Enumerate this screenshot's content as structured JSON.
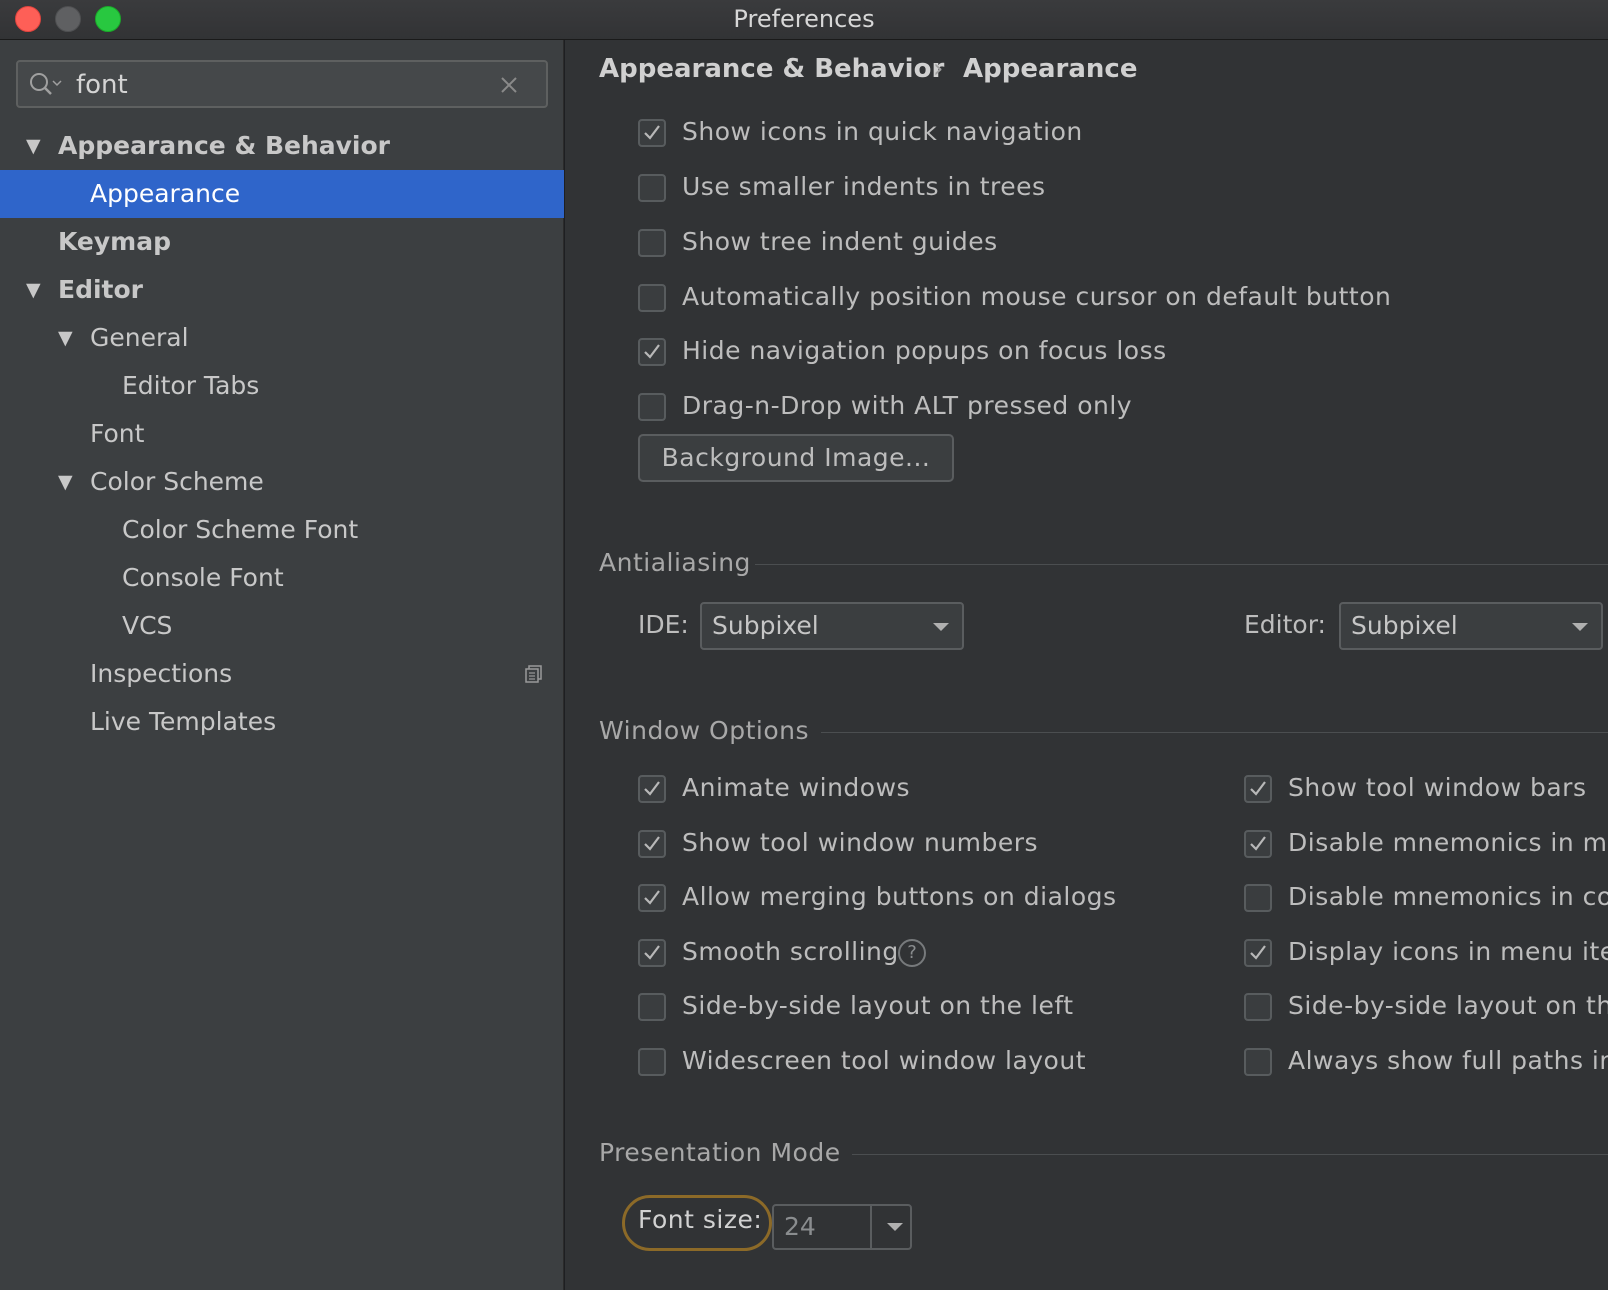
{
  "window": {
    "title": "Preferences"
  },
  "sidebar": {
    "search": {
      "value": "font"
    },
    "tree": [
      {
        "label": "Appearance & Behavior",
        "expanded": true
      },
      {
        "label": "Appearance",
        "selected": true
      },
      {
        "label": "Keymap"
      },
      {
        "label": "Editor",
        "expanded": true
      },
      {
        "label": "General",
        "expanded": true
      },
      {
        "label": "Editor Tabs"
      },
      {
        "label": "Font"
      },
      {
        "label": "Color Scheme",
        "expanded": true
      },
      {
        "label": "Color Scheme Font"
      },
      {
        "label": "Console Font"
      },
      {
        "label": "VCS"
      },
      {
        "label": "Inspections",
        "icon": "copy-icon"
      },
      {
        "label": "Live Templates"
      }
    ]
  },
  "breadcrumb": {
    "parent": "Appearance & Behavior",
    "separator": "›",
    "current": "Appearance"
  },
  "ui_options": [
    {
      "label": "Show icons in quick navigation",
      "checked": true
    },
    {
      "label": "Use smaller indents in trees",
      "checked": false
    },
    {
      "label": "Show tree indent guides",
      "checked": false
    },
    {
      "label": "Automatically position mouse cursor on default button",
      "checked": false
    },
    {
      "label": "Hide navigation popups on focus loss",
      "checked": true
    },
    {
      "label": "Drag-n-Drop with ALT pressed only",
      "checked": false
    }
  ],
  "background_image_button": "Background Image...",
  "antialiasing": {
    "title": "Antialiasing",
    "ide_label": "IDE:",
    "ide_value": "Subpixel",
    "editor_label": "Editor:",
    "editor_value": "Subpixel"
  },
  "window_options": {
    "title": "Window Options",
    "left": [
      {
        "label": "Animate windows",
        "checked": true
      },
      {
        "label": "Show tool window numbers",
        "checked": true
      },
      {
        "label": "Allow merging buttons on dialogs",
        "checked": true
      },
      {
        "label": "Smooth scrolling",
        "checked": true,
        "help": "?"
      },
      {
        "label": "Side-by-side layout on the left",
        "checked": false
      },
      {
        "label": "Widescreen tool window layout",
        "checked": false
      }
    ],
    "right": [
      {
        "label": "Show tool window bars",
        "checked": true
      },
      {
        "label": "Disable mnemonics in me",
        "checked": true
      },
      {
        "label": "Disable mnemonics in cor",
        "checked": false
      },
      {
        "label": "Display icons in menu iter",
        "checked": true
      },
      {
        "label": "Side-by-side layout on th",
        "checked": false
      },
      {
        "label": "Always show full paths in",
        "checked": false
      }
    ]
  },
  "presentation_mode": {
    "title": "Presentation Mode",
    "font_size_label": "Font size:",
    "font_size_value": "24"
  }
}
